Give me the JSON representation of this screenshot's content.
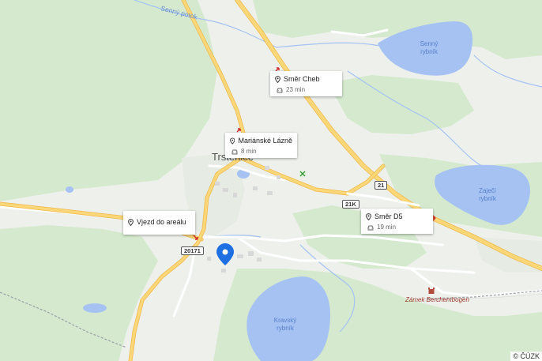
{
  "map": {
    "town_label": "Trstěnice",
    "place_labels": {
      "senny_potok": "Senný potok",
      "senny_rybnik": "Senný\nrybník",
      "zajeci_rybnik": "Zaječí\nrybník",
      "kravsky_rybnik": "Kravský\nrybník",
      "zamek": "Zámek Berchembogen"
    },
    "road_shields": {
      "r21": "21",
      "r21k": "21K",
      "r20171": "20171"
    },
    "copyright": "© ČÚZK"
  },
  "directions": [
    {
      "title": "Směr Cheb",
      "time": "23 min"
    },
    {
      "title": "Mariánské Lázně",
      "time": "8 min"
    },
    {
      "title": "Směr D5",
      "time": "19 min"
    },
    {
      "title": "Vjezd do areálu",
      "time": ""
    }
  ],
  "colors": {
    "land": "#eef0ec",
    "forest": "#d4e9ce",
    "water": "#a5c2f3",
    "road_major": "#fbd777",
    "road_major_edge": "#f0b84f",
    "road_minor": "#ffffff",
    "pin": "#1d6fe2",
    "turn_arrow": "#d32f2f"
  },
  "icons": {
    "card_pin": "map-pin-icon",
    "car": "car-icon",
    "turn": "turn-arrow-icon",
    "location": "location-pin-icon",
    "recreation": "recreation-icon",
    "castle": "castle-icon"
  }
}
